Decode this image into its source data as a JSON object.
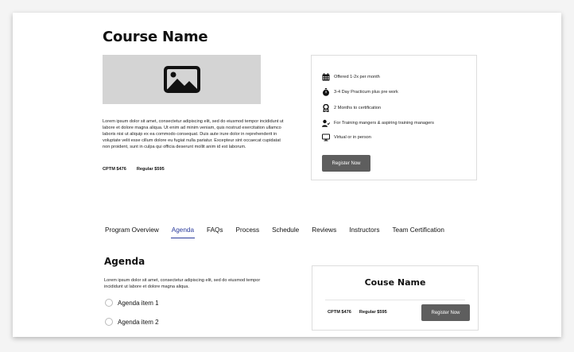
{
  "course": {
    "title": "Course Name",
    "description": "Lorem ipsum dolor sit amet, consectetur adipiscing elit, sed do eiusmod tempor incididunt ut labore et dolore magna aliqua. Ut enim ad minim veniam, quis nostrud exercitation ullamco laboris nisi ut aliquip ex ea commodo consequat. Duis aute irure dolor in reprehenderit in voluptate velit esse cillum dolore eu fugiat nulla pariatur. Excepteur sint occaecat cupidatat non proident, sunt in culpa qui officia deserunt mollit anim id est laborum.",
    "price_cptm": "CPTM $476",
    "price_regular": "Regular $595",
    "hero_icon": "image-placeholder-icon"
  },
  "info": {
    "features": [
      {
        "icon": "calendar-icon",
        "text": "Offered 1-2x per month"
      },
      {
        "icon": "stopwatch-icon",
        "text": "3-4 Day Practicum plus pre work"
      },
      {
        "icon": "award-icon",
        "text": "2 Months to certification"
      },
      {
        "icon": "user-check-icon",
        "text": "For Training mangers & aspiring training managers"
      },
      {
        "icon": "monitor-icon",
        "text": "Virtual or in person"
      }
    ],
    "register_label": "Register Now"
  },
  "tabs": [
    {
      "label": "Program Overview",
      "active": false
    },
    {
      "label": "Agenda",
      "active": true
    },
    {
      "label": "FAQs",
      "active": false
    },
    {
      "label": "Process",
      "active": false
    },
    {
      "label": "Schedule",
      "active": false
    },
    {
      "label": "Reviews",
      "active": false
    },
    {
      "label": "Instructors",
      "active": false
    },
    {
      "label": "Team Certification",
      "active": false
    }
  ],
  "agenda": {
    "heading": "Agenda",
    "description": "Lorem ipsum dolor sit amet, consectetur adipiscing elit, sed do eiusmod tempor incididunt ut labore et dolore magna aliqua.",
    "items": [
      "Agenda item 1",
      "Agenda item 2"
    ]
  },
  "sidebar_card": {
    "title": "Couse Name",
    "price_cptm": "CPTM $476",
    "price_regular": "Regular $595",
    "register_label": "Register Now"
  },
  "colors": {
    "accent": "#2a3b9c",
    "button": "#5e5e5e",
    "placeholder": "#d4d4d4"
  }
}
